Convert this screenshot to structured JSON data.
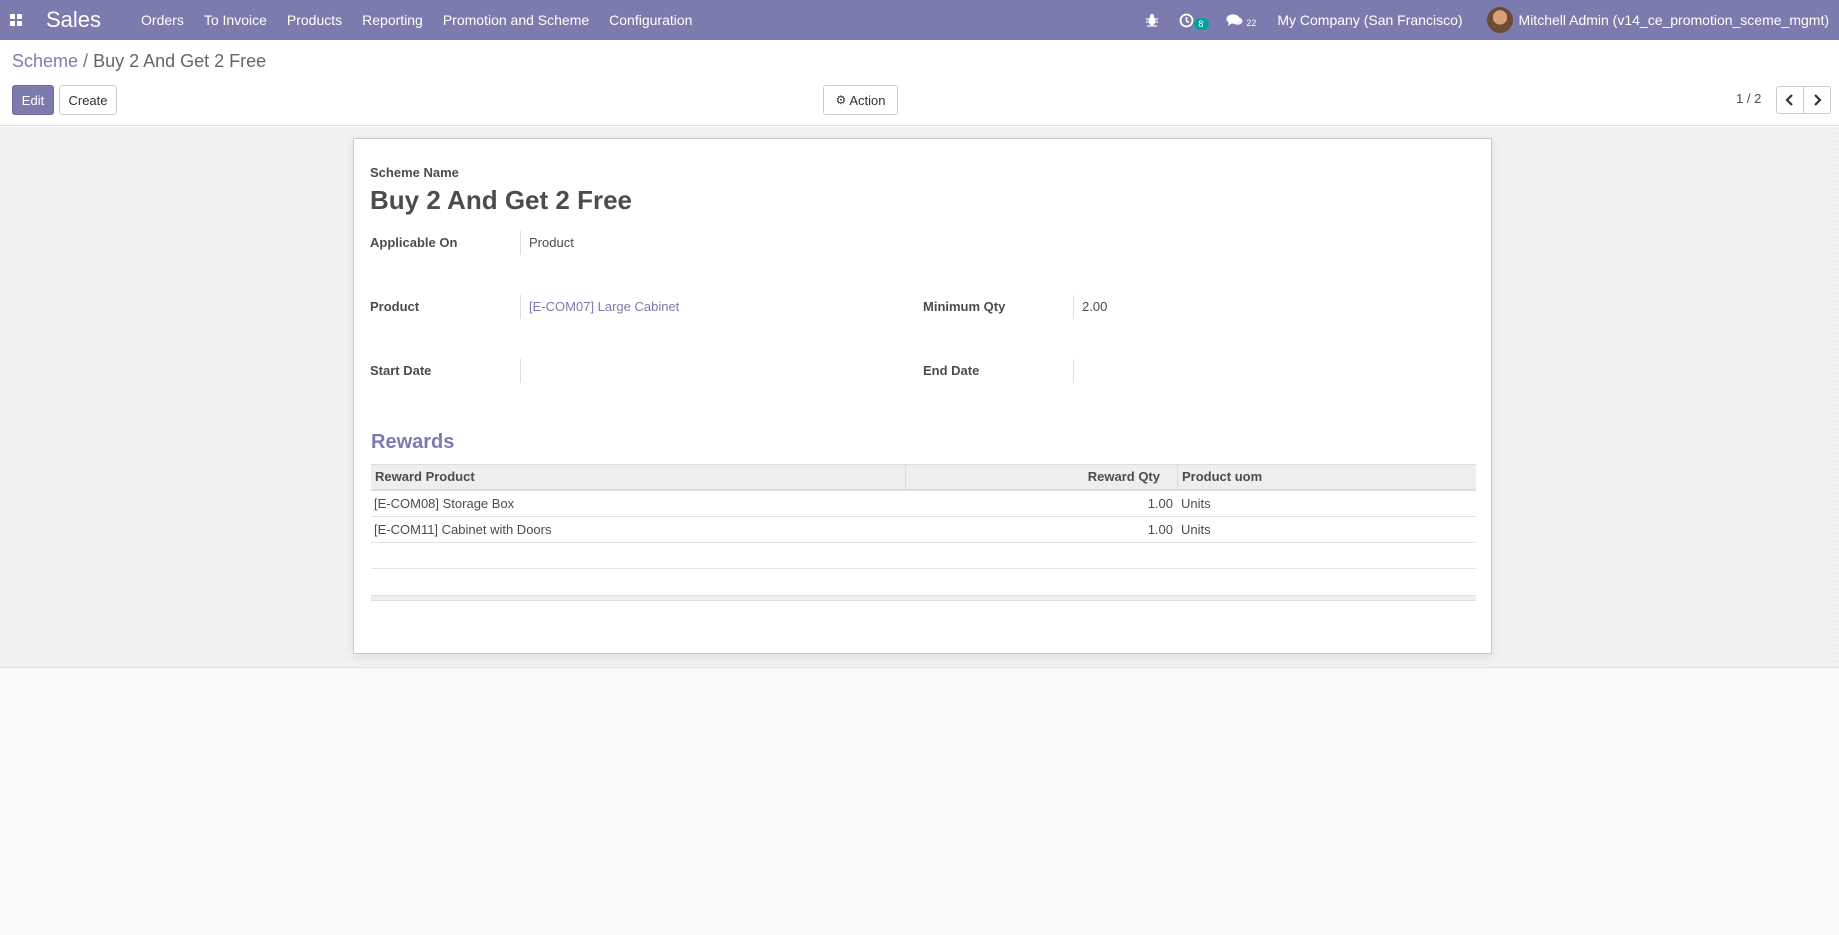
{
  "navbar": {
    "app_name": "Sales",
    "menu": [
      "Orders",
      "To Invoice",
      "Products",
      "Reporting",
      "Promotion and Scheme",
      "Configuration"
    ],
    "activity_badge": "8",
    "messages_badge": "22",
    "company": "My Company (San Francisco)",
    "user": "Mitchell Admin (v14_ce_promotion_sceme_mgmt)"
  },
  "breadcrumb": {
    "parent": "Scheme",
    "separator": "/",
    "current": "Buy 2 And Get 2 Free"
  },
  "buttons": {
    "edit": "Edit",
    "create": "Create",
    "action": "Action"
  },
  "pager": {
    "value": "1 / 2"
  },
  "form": {
    "scheme_name_label": "Scheme Name",
    "scheme_name": "Buy 2 And Get 2 Free",
    "applicable_on_label": "Applicable On",
    "applicable_on": "Product",
    "product_label": "Product",
    "product": "[E-COM07] Large Cabinet",
    "min_qty_label": "Minimum Qty",
    "min_qty": "2.00",
    "start_date_label": "Start Date",
    "start_date": "",
    "end_date_label": "End Date",
    "end_date": ""
  },
  "rewards": {
    "title": "Rewards",
    "columns": [
      "Reward Product",
      "Reward Qty",
      "Product uom"
    ],
    "rows": [
      [
        "[E-COM08] Storage Box",
        "1.00",
        "Units"
      ],
      [
        "[E-COM11] Cabinet with Doors",
        "1.00",
        "Units"
      ]
    ]
  },
  "colors": {
    "brand": "#7c7bad",
    "badge": "#00a09d"
  }
}
